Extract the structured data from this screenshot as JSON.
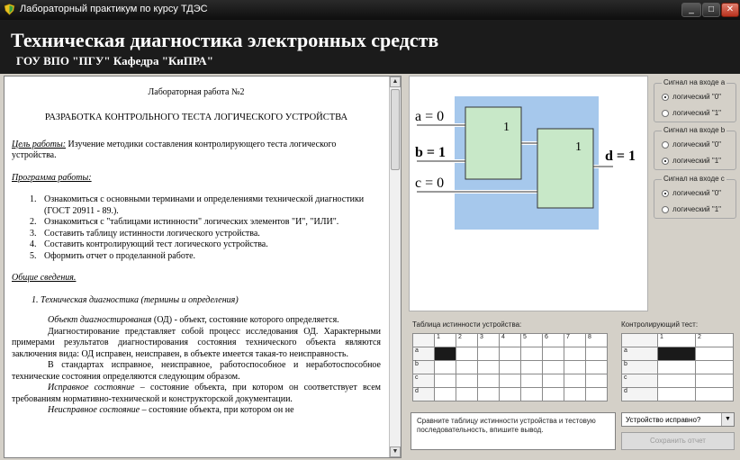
{
  "window": {
    "title": "Лабораторный практикум по курсу ТДЭС",
    "min": "_",
    "max": "□",
    "close": "✕"
  },
  "header": {
    "title": "Техническая диагностика электронных средств",
    "subtitle": "ГОУ ВПО \"ПГУ\"  Кафедра \"КиПРА\""
  },
  "doc": {
    "lab_no": "Лабораторная работа №2",
    "lab_title": "РАЗРАБОТКА КОНТРОЛЬНОГО ТЕСТА ЛОГИЧЕСКОГО УСТРОЙСТВА",
    "goal_label": "Цель работы:",
    "goal_text": " Изучение методики составления контролирующего теста логического устройства.",
    "program_label": "Программа работы:",
    "program_items": [
      "Ознакомиться с основными терминами и определениями технической диагностики (ГОСТ 20911 - 89.).",
      "Ознакомиться с \"таблицами истинности\"  логических элементов \"И\", \"ИЛИ\".",
      "Составить таблицу истинности логического устройства.",
      "Составить контролирующий тест логического устройства.",
      "Оформить отчет о проделанной работе."
    ],
    "general_label": "Общие сведения.",
    "section1": "1.  Техническая диагностика (термины и определения)",
    "p1_term": "Объект  диагностирования",
    "p1_rest": " (ОД)  -  объект,  состояние  которого определяется.",
    "p2": "Диагностирование  представляет  собой  процесс  исследования  ОД. Характерными примерами результатов диагностирования состояния технического объекта являются заключения вида: ОД исправен, неисправен, в объекте имеется такая-то неисправность.",
    "p3": "В  стандартах  исправное,  неисправное,  работоспособное  и неработоспособное технические состояния определяются следующим образом.",
    "p4_term": "Исправное состояние",
    "p4_rest": " – состояние объекта, при котором он соответствует всем требованиям нормативно-технической и конструкторской документации.",
    "p5_term": "Неисправное состояние",
    "p5_rest": " – состояние объекта, при котором он не"
  },
  "diagram": {
    "gate1_label": "1",
    "gate2_label": "1",
    "input_a": "a = 0",
    "input_b": "b = 1",
    "input_c": "c = 0",
    "output_d": "d = 1",
    "colors": {
      "panel": "#a6c8ec",
      "gate": "#c8e8c8"
    }
  },
  "signals": [
    {
      "legend": "Сигнал на входе a",
      "opt0": "логический \"0\"",
      "opt1": "логический \"1\"",
      "selected": 0
    },
    {
      "legend": "Сигнал на входе b",
      "opt0": "логический \"0\"",
      "opt1": "логический \"1\"",
      "selected": 1
    },
    {
      "legend": "Сигнал на входе c",
      "opt0": "логический \"0\"",
      "opt1": "логический \"1\"",
      "selected": 0
    }
  ],
  "truth_table": {
    "label": "Таблица истинности устройства:",
    "columns": [
      "1",
      "2",
      "3",
      "4",
      "5",
      "6",
      "7",
      "8"
    ],
    "rows": [
      "a",
      "b",
      "c",
      "d"
    ]
  },
  "test_table": {
    "label": "Контролирующий тест:",
    "columns": [
      "1",
      "2"
    ],
    "rows": [
      "a",
      "b",
      "c",
      "d"
    ]
  },
  "hint": "Сравните таблицу истинности устройства и тестовую последовательность, впишите вывод.",
  "device_select": {
    "value": "Устройство исправно?"
  },
  "save_button": "Сохранить отчет"
}
